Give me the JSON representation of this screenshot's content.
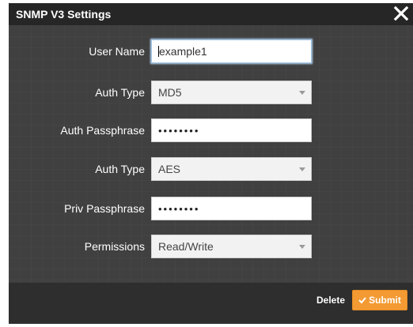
{
  "dialog": {
    "title": "SNMP V3 Settings",
    "close_icon": "close-icon"
  },
  "form": {
    "user_name": {
      "label": "User Name",
      "value": "example1"
    },
    "auth_type": {
      "label": "Auth Type",
      "value": "MD5"
    },
    "auth_passphrase": {
      "label": "Auth Passphrase",
      "value": "••••••••"
    },
    "priv_type": {
      "label": "Auth Type",
      "value": "AES"
    },
    "priv_passphrase": {
      "label": "Priv Passphrase",
      "value": "••••••••"
    },
    "permissions": {
      "label": "Permissions",
      "value": "Read/Write"
    }
  },
  "footer": {
    "delete_label": "Delete",
    "submit_label": "Submit",
    "submit_color": "#f39a33"
  },
  "colors": {
    "titlebar": "#262626",
    "body": "#404040",
    "footer": "#2e2e2e"
  }
}
